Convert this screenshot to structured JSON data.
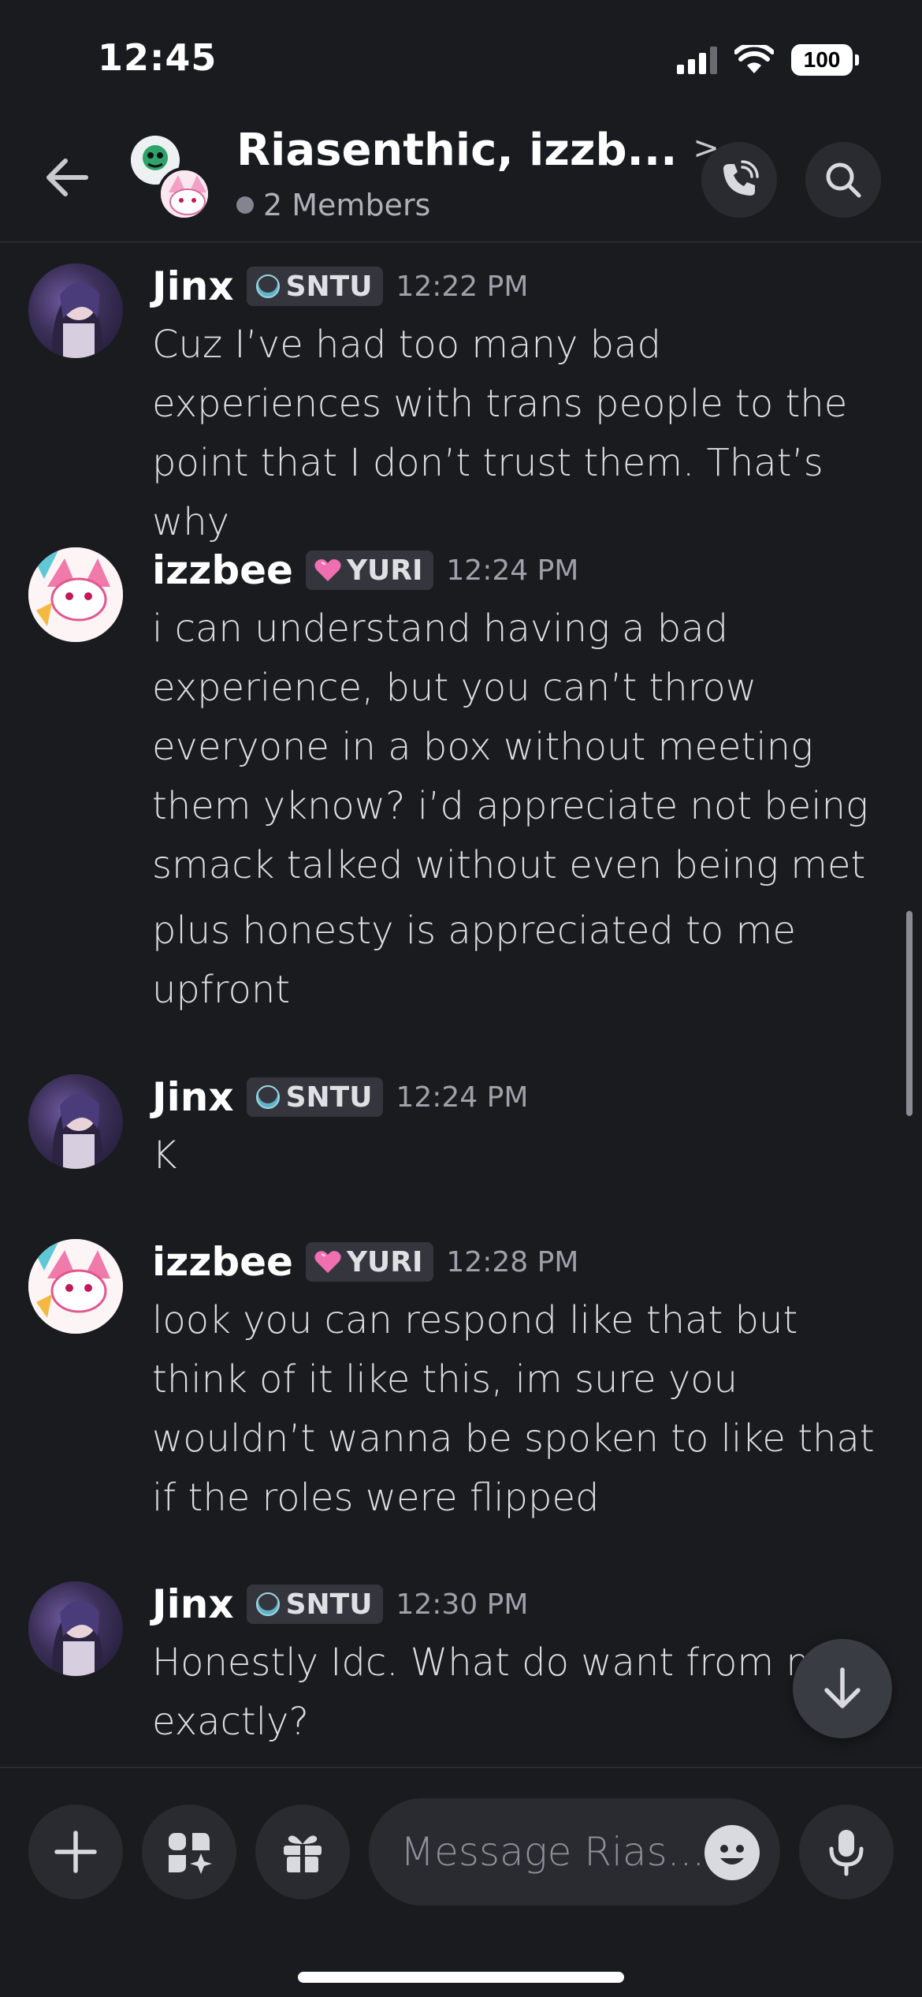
{
  "status_bar": {
    "time": "12:45",
    "battery": "100"
  },
  "header": {
    "title": "Riasenthic, izzb...",
    "chevron": ">",
    "members": "2 Members"
  },
  "messages": [
    {
      "author": "Jinx",
      "role": "SNTU",
      "role_icon": "moon-orb-icon",
      "time": "12:22 PM",
      "lines": [
        "Cuz I’ve had too many bad experiences with trans people to the point that I don’t trust them. That’s why"
      ]
    },
    {
      "author": "izzbee",
      "role": "YURI",
      "role_icon": "pink-heart-icon",
      "time": "12:24 PM",
      "lines": [
        "i can understand having a bad experience, but you can’t throw everyone in a box without meeting them yknow? i’d appreciate not being smack talked without even being met",
        "plus honesty is appreciated to me upfront"
      ]
    },
    {
      "author": "Jinx",
      "role": "SNTU",
      "role_icon": "moon-orb-icon",
      "time": "12:24 PM",
      "lines": [
        "K"
      ]
    },
    {
      "author": "izzbee",
      "role": "YURI",
      "role_icon": "pink-heart-icon",
      "time": "12:28 PM",
      "lines": [
        "look you can respond like that but think of it like this, im sure you wouldn’t wanna be spoken to like that if the roles were flipped"
      ]
    },
    {
      "author": "Jinx",
      "role": "SNTU",
      "role_icon": "moon-orb-icon",
      "time": "12:30 PM",
      "lines": [
        "Honestly Idc. What do want from me exactly?"
      ]
    }
  ],
  "composer": {
    "placeholder": "Message Rias..."
  },
  "colors": {
    "background": "#1a1b1f",
    "surface": "#2a2b30",
    "role_tag": "#35363d"
  }
}
